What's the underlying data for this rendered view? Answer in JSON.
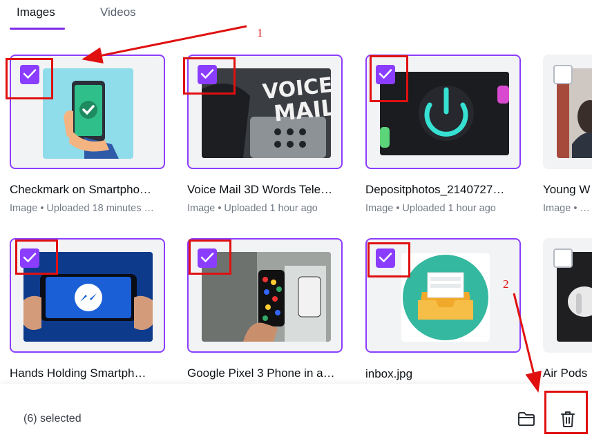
{
  "tabs": [
    {
      "label": "Images",
      "active": true
    },
    {
      "label": "Videos",
      "active": false
    }
  ],
  "items": [
    {
      "title": "Checkmark on Smartpho…",
      "meta": "Image • Uploaded 18 minutes …",
      "selected": true
    },
    {
      "title": "Voice Mail 3D Words Tele…",
      "meta": "Image • Uploaded 1 hour ago",
      "selected": true,
      "thumb_text": [
        "VOICE",
        "MAIL"
      ]
    },
    {
      "title": "Depositphotos_2140727…",
      "meta": "Image • Uploaded 1 hour ago",
      "selected": true
    },
    {
      "title": "Young W",
      "meta": "Image • Up",
      "selected": false
    },
    {
      "title": "Hands Holding Smartph…",
      "meta": "",
      "selected": true
    },
    {
      "title": "Google Pixel 3 Phone in a…",
      "meta": "",
      "selected": true
    },
    {
      "title": "inbox.jpg",
      "meta": "",
      "selected": true
    },
    {
      "title": "Air Pods",
      "meta": "",
      "selected": false
    }
  ],
  "footer": {
    "selected_label": "(6) selected",
    "folder_icon": "folder-icon",
    "delete_icon": "trash-icon"
  },
  "annotations": {
    "one": "1",
    "two": "2"
  },
  "colors": {
    "accent": "#8b3dff",
    "annotation": "#e01010"
  }
}
